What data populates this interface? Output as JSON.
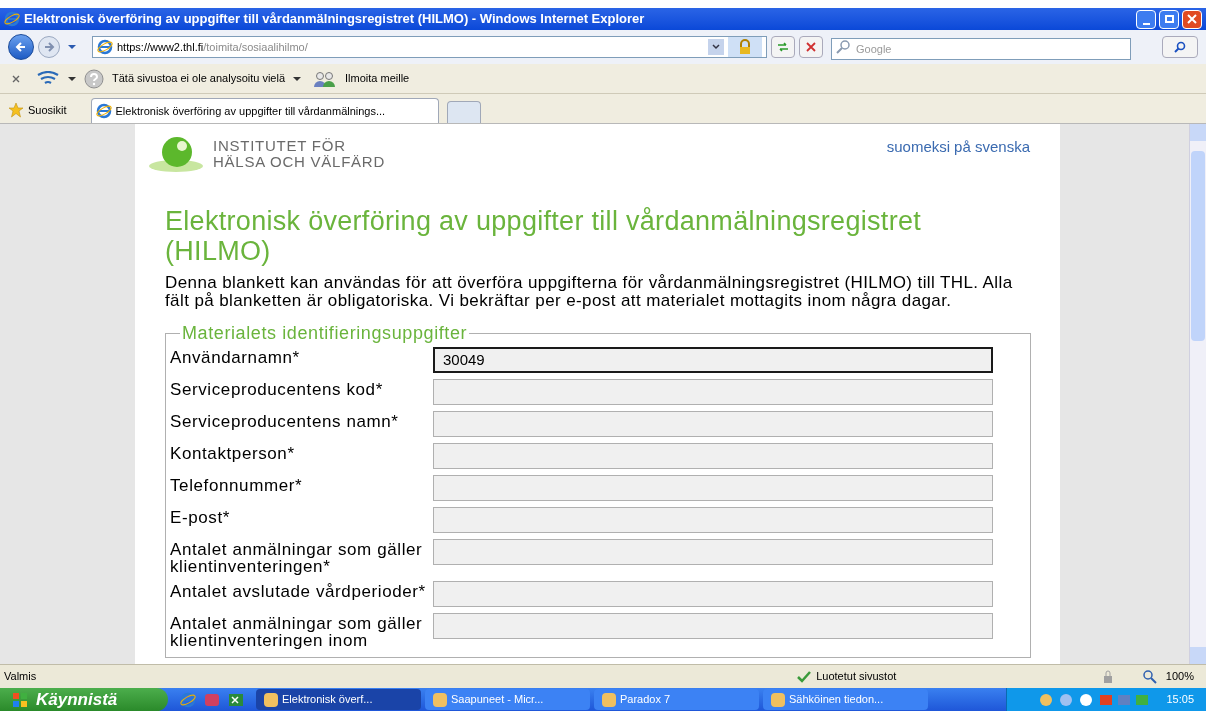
{
  "window": {
    "title": "Elektronisk överföring av uppgifter till vårdanmälningsregistret (HILMO) - Windows Internet Explorer"
  },
  "address_bar": {
    "url_host": "https://www2.thl.fi",
    "url_path": "/toimita/sosiaalihilmo/"
  },
  "search": {
    "placeholder": "Google"
  },
  "toolbar": {
    "site_status": "Tätä sivustoa ei ole analysoitu vielä",
    "report": "Ilmoita meille"
  },
  "favorites": {
    "label": "Suosikit"
  },
  "tabs": [
    {
      "label": "Elektronisk överföring av uppgifter till vårdanmälnings...",
      "selected": true
    }
  ],
  "page": {
    "org_name": [
      "INSTITUTET FÖR",
      "HÄLSA OCH VÄLFÄRD"
    ],
    "language_links": [
      {
        "label": "suomeksi"
      },
      {
        "label": "på svenska"
      }
    ],
    "heading": "Elektronisk överföring av uppgifter till vårdanmälningsregistret (HILMO)",
    "intro": "Denna blankett kan användas för att överföra uppgifterna för vårdanmälningsregistret (HILMO) till THL. Alla fält på blanketten är obligatoriska. Vi bekräftar per e-post att materialet mottagits inom några dagar.",
    "fieldset": {
      "legend": "Materialets identifieringsuppgifter",
      "fields": [
        {
          "label": "Användarnamn*",
          "value": "30049",
          "focused": true
        },
        {
          "label": "Serviceproducentens kod*",
          "focused": false
        },
        {
          "label": "Serviceproducentens namn*",
          "focused": false
        },
        {
          "label": "Kontaktperson*",
          "focused": false
        },
        {
          "label": "Telefonnummer*",
          "focused": false
        },
        {
          "label": "E-post*",
          "focused": false
        },
        {
          "label": "Antalet anmälningar som gäller klientinventeringen*",
          "focused": false
        },
        {
          "label": "Antalet avslutade vårdperioder*",
          "focused": false
        },
        {
          "label": "Antalet anmälningar som gäller klientinventeringen inom",
          "focused": false
        }
      ]
    }
  },
  "status_bar": {
    "text": "Valmis",
    "zone": "Luotetut sivustot",
    "zoom": "100%"
  },
  "taskbar": {
    "start": "Käynnistä",
    "tasks": [
      {
        "label": "Elektronisk överf...",
        "selected": true
      },
      {
        "label": "Saapuneet - Micr...",
        "selected": false
      },
      {
        "label": "Paradox 7",
        "selected": false
      },
      {
        "label": "Sähköinen tiedon...",
        "selected": false
      }
    ],
    "clock": "15:05"
  }
}
